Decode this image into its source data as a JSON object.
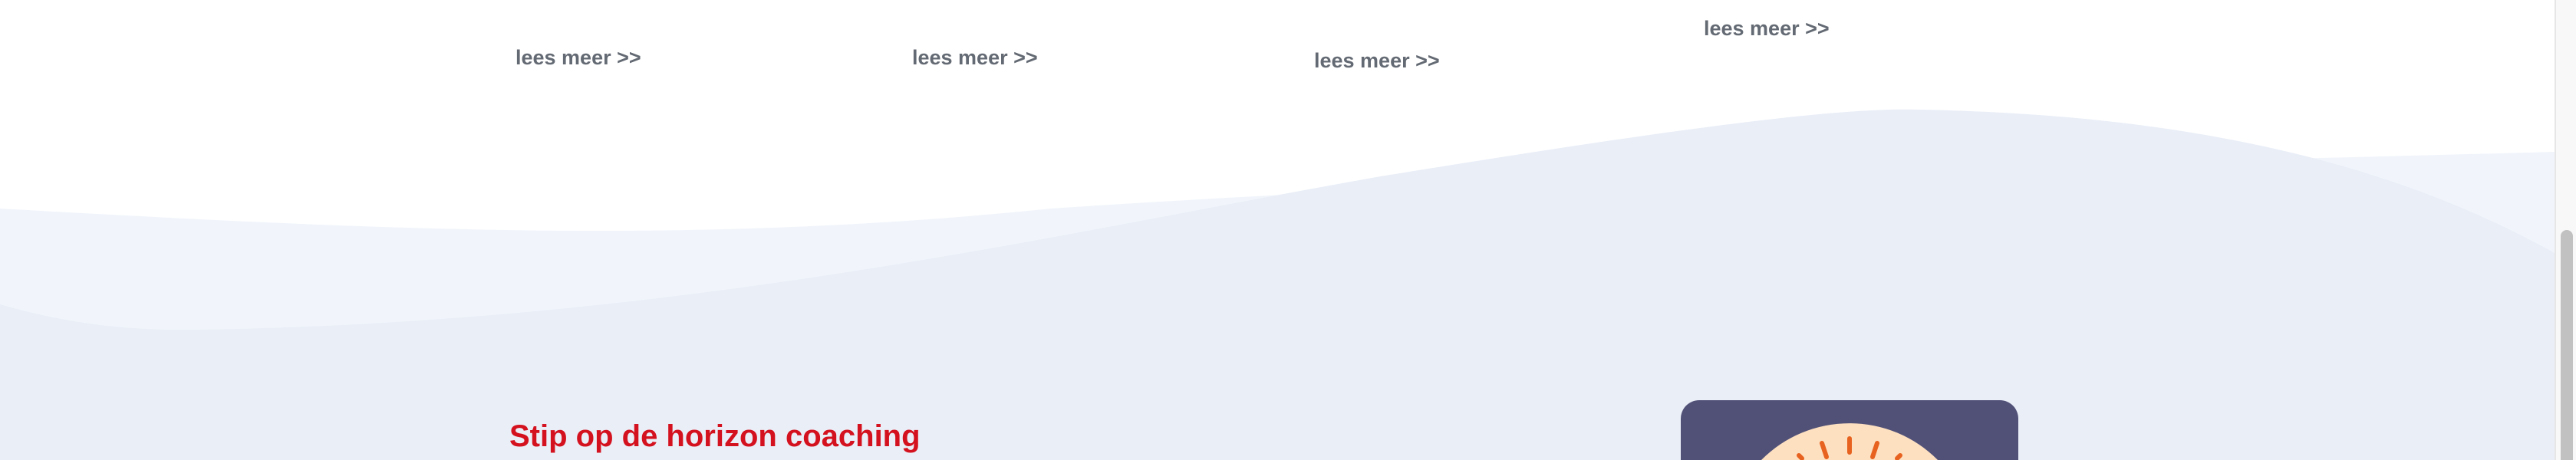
{
  "cards": [
    {
      "link_label": "lees meer >>"
    },
    {
      "link_label": "lees meer >>"
    },
    {
      "link_label": "lees meer >>"
    },
    {
      "link_label": "lees meer >>"
    }
  ],
  "section": {
    "title": "Stip op de horizon coaching"
  },
  "colors": {
    "title": "#d4111e",
    "link": "#646a73",
    "card_bg": "#515178",
    "sun": "#fde0c0",
    "rays": "#e8621f",
    "wave_light": "#f1f5fb",
    "wave_main": "#e9eef7"
  }
}
